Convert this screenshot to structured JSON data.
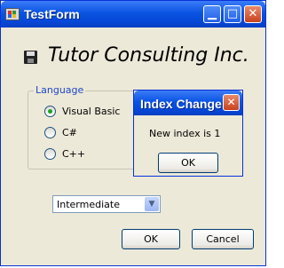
{
  "window": {
    "title": "TestForm",
    "minimize": "▁",
    "maximize": "□",
    "close": "✕"
  },
  "heading": {
    "icon": "floppy-disk-icon",
    "text": "Tutor Consulting Inc."
  },
  "language_group": {
    "label": "Language",
    "options": [
      {
        "label": "Visual Basic",
        "checked": true
      },
      {
        "label": "C#",
        "checked": false
      },
      {
        "label": "C++",
        "checked": false
      }
    ]
  },
  "level_select": {
    "value": "Intermediate",
    "arrow": "▼"
  },
  "buttons": {
    "ok": "OK",
    "cancel": "Cancel"
  },
  "dialog": {
    "title": "Index Change",
    "close": "✕",
    "message": "New index is 1",
    "ok": "OK"
  },
  "colors": {
    "titlebar": "#0a54e3",
    "face": "#ece9d8",
    "group_label": "#1f46c8",
    "radio_dot": "#21a121",
    "close_button": "#c9421e"
  }
}
